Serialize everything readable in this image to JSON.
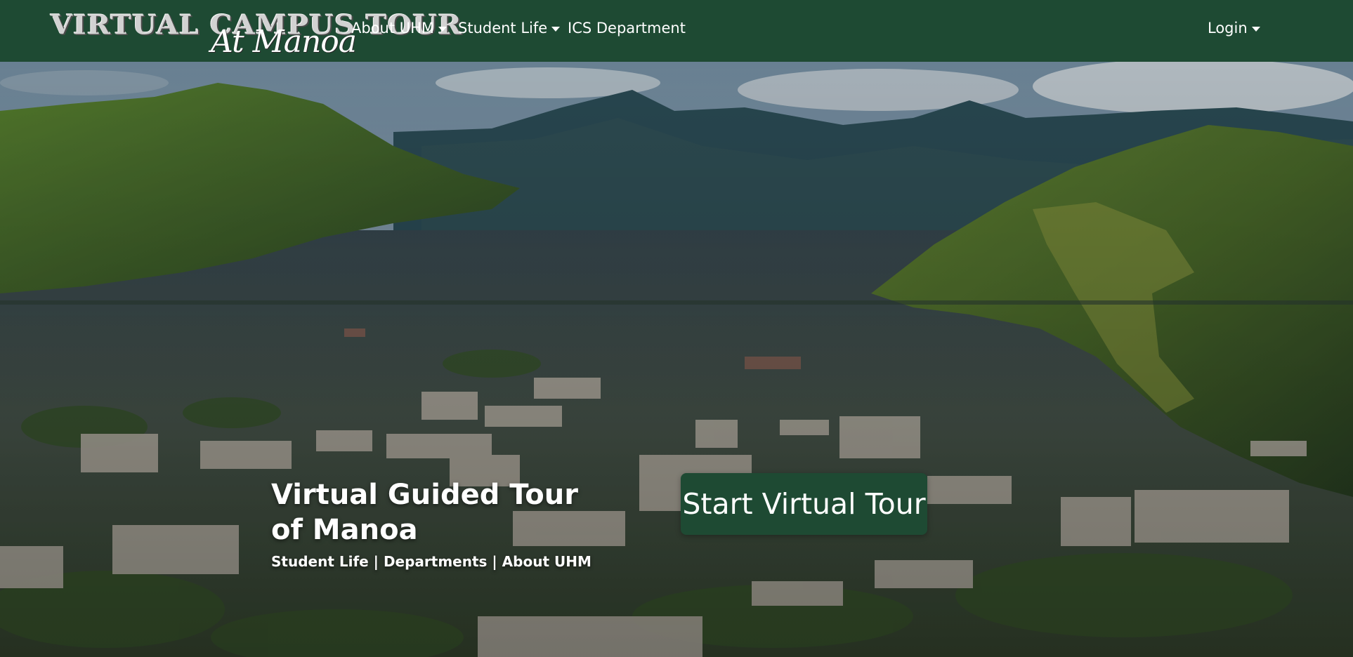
{
  "brand": {
    "title": "VIRTUAL CAMPUS TOUR",
    "script": "At Manoa"
  },
  "nav": {
    "items": [
      {
        "label": "About UHM",
        "dropdown": true
      },
      {
        "label": "Student Life",
        "dropdown": true
      },
      {
        "label": "ICS Department",
        "dropdown": false
      }
    ],
    "login": {
      "label": "Login",
      "dropdown": true
    }
  },
  "hero": {
    "title": "Virtual Guided Tour of Manoa",
    "subtitle": "Student Life | Departments | About UHM",
    "cta_label": "Start Virtual Tour",
    "background": "aerial-photo-manoa-valley"
  },
  "colors": {
    "navbar": "#1e4a33",
    "cta": "#1e4a33",
    "text": "#ffffff"
  }
}
